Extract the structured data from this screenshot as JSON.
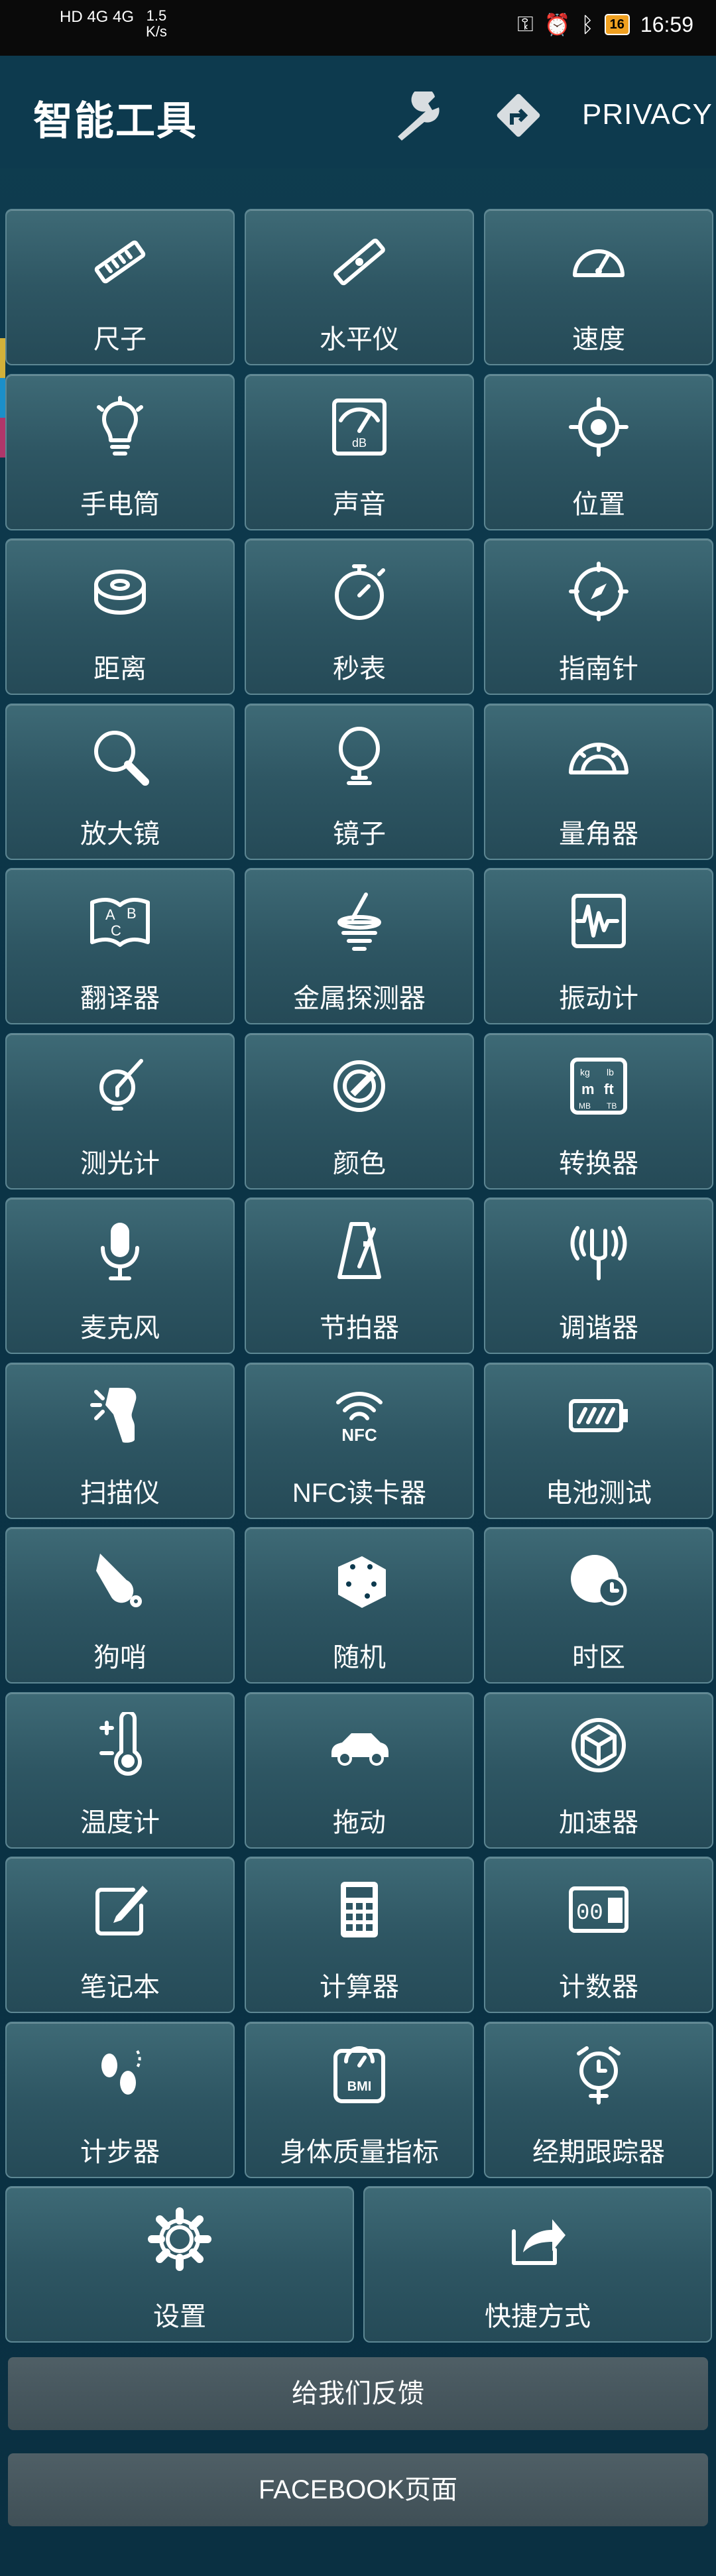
{
  "status": {
    "left_top": "HD 4G 4G",
    "net_speed": "1.5",
    "net_unit": "K/s",
    "battery": "16",
    "time": "16:59"
  },
  "appbar": {
    "title": "智能工具",
    "privacy": "PRIVACY"
  },
  "tools": [
    {
      "label": "尺子",
      "icon": "ruler-icon"
    },
    {
      "label": "水平仪",
      "icon": "level-icon"
    },
    {
      "label": "速度",
      "icon": "speedometer-icon"
    },
    {
      "label": "手电筒",
      "icon": "bulb-icon"
    },
    {
      "label": "声音",
      "icon": "db-meter-icon"
    },
    {
      "label": "位置",
      "icon": "target-icon"
    },
    {
      "label": "距离",
      "icon": "tape-measure-icon"
    },
    {
      "label": "秒表",
      "icon": "stopwatch-icon"
    },
    {
      "label": "指南针",
      "icon": "compass-icon"
    },
    {
      "label": "放大镜",
      "icon": "magnifier-icon"
    },
    {
      "label": "镜子",
      "icon": "mirror-icon"
    },
    {
      "label": "量角器",
      "icon": "protractor-icon"
    },
    {
      "label": "翻译器",
      "icon": "translate-book-icon"
    },
    {
      "label": "金属探测器",
      "icon": "metal-detector-icon"
    },
    {
      "label": "振动计",
      "icon": "vibration-icon"
    },
    {
      "label": "测光计",
      "icon": "light-meter-icon"
    },
    {
      "label": "颜色",
      "icon": "color-picker-icon"
    },
    {
      "label": "转换器",
      "icon": "converter-icon"
    },
    {
      "label": "麦克风",
      "icon": "microphone-icon"
    },
    {
      "label": "节拍器",
      "icon": "metronome-icon"
    },
    {
      "label": "调谐器",
      "icon": "tuning-fork-icon"
    },
    {
      "label": "扫描仪",
      "icon": "barcode-scanner-icon"
    },
    {
      "label": "NFC读卡器",
      "icon": "nfc-icon"
    },
    {
      "label": "电池测试",
      "icon": "battery-icon"
    },
    {
      "label": "狗哨",
      "icon": "whistle-icon"
    },
    {
      "label": "随机",
      "icon": "dice-icon"
    },
    {
      "label": "时区",
      "icon": "globe-clock-icon"
    },
    {
      "label": "温度计",
      "icon": "thermometer-icon"
    },
    {
      "label": "拖动",
      "icon": "car-icon"
    },
    {
      "label": "加速器",
      "icon": "accelerometer-icon"
    },
    {
      "label": "笔记本",
      "icon": "notepad-icon"
    },
    {
      "label": "计算器",
      "icon": "calculator-icon"
    },
    {
      "label": "计数器",
      "icon": "counter-icon"
    },
    {
      "label": "计步器",
      "icon": "footsteps-icon"
    },
    {
      "label": "身体质量指标",
      "icon": "bmi-scale-icon"
    },
    {
      "label": "经期跟踪器",
      "icon": "alarm-female-icon"
    }
  ],
  "bottom_tiles": [
    {
      "label": "设置",
      "icon": "gear-icon"
    },
    {
      "label": "快捷方式",
      "icon": "share-icon"
    }
  ],
  "feedback": "给我们反馈",
  "facebook": "FACEBOOK页面"
}
